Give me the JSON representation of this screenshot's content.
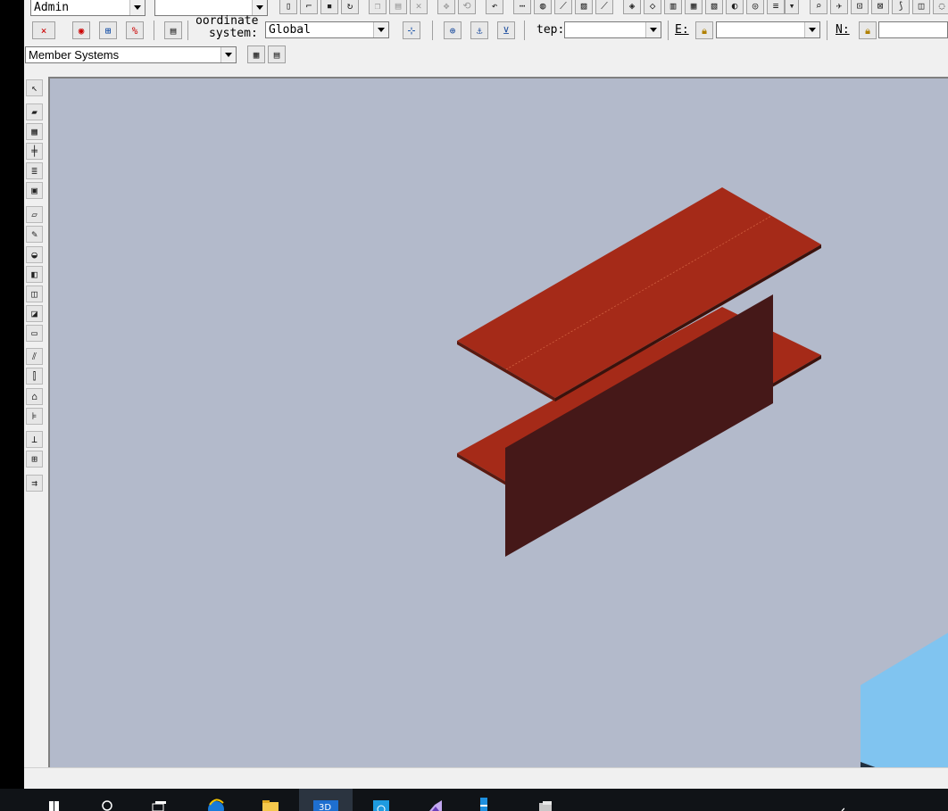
{
  "toolbar_row1": {
    "user_select": "Admin",
    "blank_select": ""
  },
  "toolbar_row2": {
    "coordinate_label_line1": "oordinate",
    "coordinate_label_line2": "system:",
    "coordinate_value": "Global",
    "step_label": "tep:",
    "step_value": "",
    "e_label": "E:",
    "e_value": "",
    "n_label": "N:",
    "n_value": ""
  },
  "toolbar_row3": {
    "filter_select": "Member Systems"
  },
  "viewport": {
    "background": "#b3bacb",
    "beam_flange_color": "#a52a18",
    "beam_web_color": "#451818"
  },
  "vertical_tools": [
    {
      "name": "select-arrow-icon",
      "glyph": "↖"
    },
    {
      "name": "place-member-icon",
      "glyph": "▰"
    },
    {
      "name": "member-grid-icon",
      "glyph": "▦"
    },
    {
      "name": "split-member-icon",
      "glyph": "╪"
    },
    {
      "name": "stack-icon",
      "glyph": "≣"
    },
    {
      "name": "box-icon",
      "glyph": "▣"
    },
    {
      "name": "plate-icon",
      "glyph": "▱"
    },
    {
      "name": "pen-icon",
      "glyph": "✎"
    },
    {
      "name": "slab-icon",
      "glyph": "◒"
    },
    {
      "name": "wall-icon",
      "glyph": "◧"
    },
    {
      "name": "cylinder-icon",
      "glyph": "◫"
    },
    {
      "name": "opening-icon",
      "glyph": "◪"
    },
    {
      "name": "flat-plate-icon",
      "glyph": "▭"
    },
    {
      "name": "brace-icon",
      "glyph": "⫽"
    },
    {
      "name": "column-icon",
      "glyph": "⫿"
    },
    {
      "name": "roof-icon",
      "glyph": "⌂"
    },
    {
      "name": "stair-icon",
      "glyph": "⊧"
    },
    {
      "name": "footing-icon",
      "glyph": "⊥"
    },
    {
      "name": "ladder-icon",
      "glyph": "⊞"
    },
    {
      "name": "handrail-icon",
      "glyph": "⇉"
    }
  ]
}
